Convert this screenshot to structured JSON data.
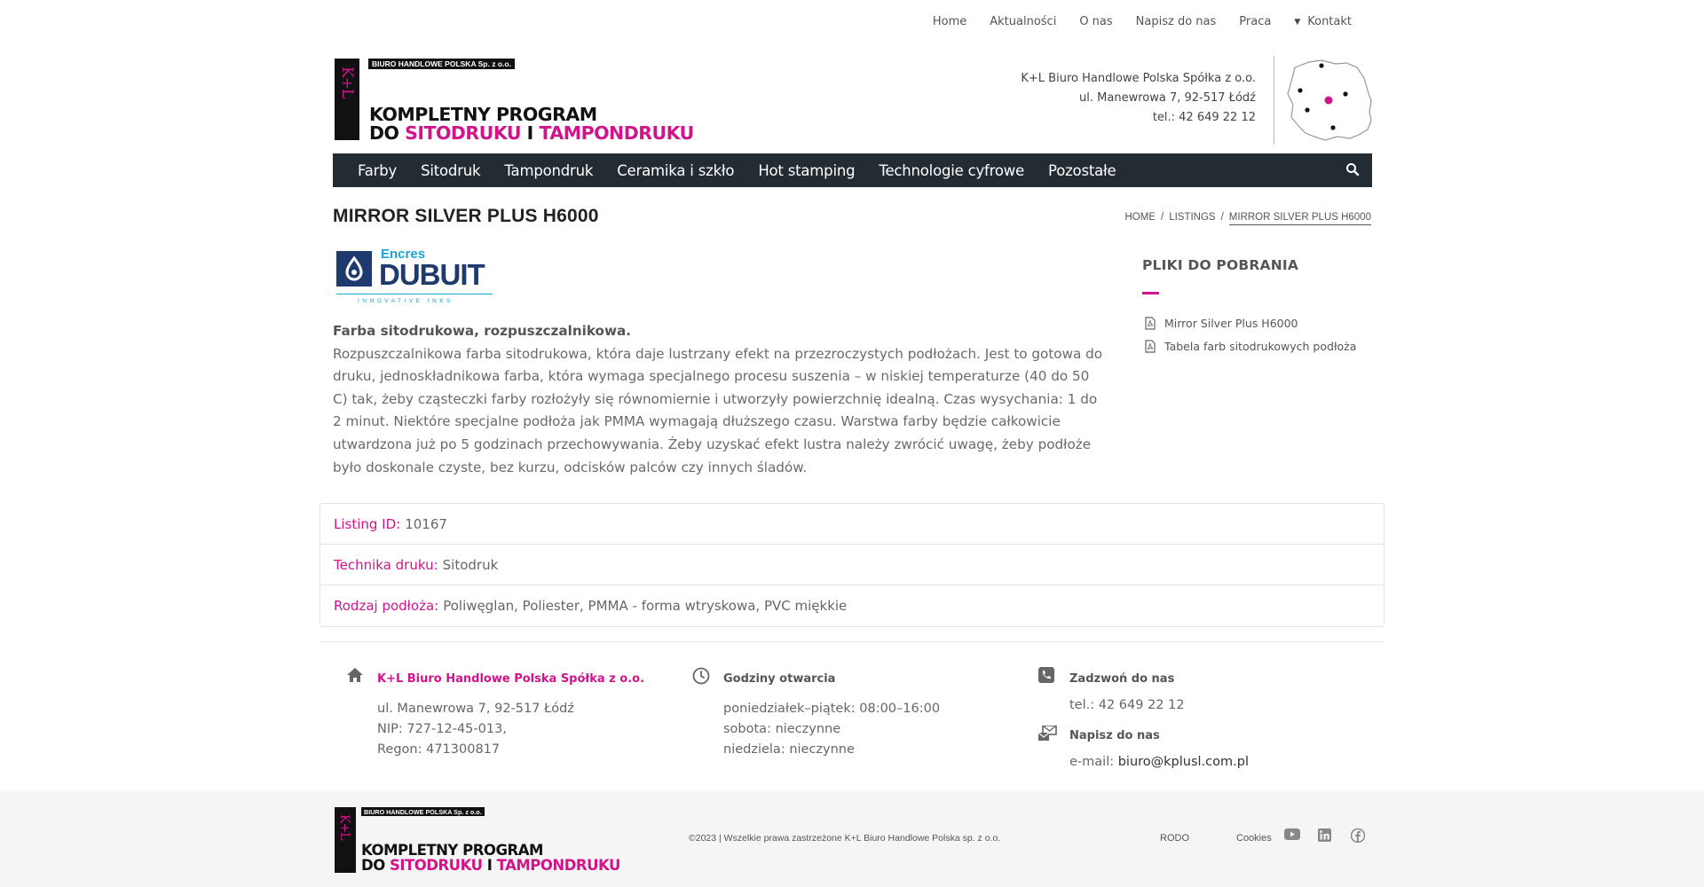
{
  "topnav": {
    "items": [
      "Home",
      "Aktualności",
      "O nas",
      "Napisz do nas",
      "Praca",
      "Kontakt"
    ]
  },
  "logo": {
    "band": "BIURO HANDLOWE POLSKA Sp. z o.o.",
    "letters": "K+L",
    "line1": "KOMPLETNY PROGRAM",
    "line2_prefix": "DO ",
    "line2_pink1": "SITODRUKU",
    "line2_mid": " I ",
    "line2_pink2": "TAMPONDRUKU"
  },
  "header_address": {
    "company": "K+L Biuro Handlowe Polska Spółka z o.o.",
    "street": "ul. Manewrowa 7, 92-517 Łódź",
    "phone": "tel.: 42 649 22 12"
  },
  "mainnav": {
    "items": [
      "Farby",
      "Sitodruk",
      "Tampondruk",
      "Ceramika i szkło",
      "Hot stamping",
      "Technologie cyfrowe",
      "Pozostałe"
    ]
  },
  "page": {
    "title": "MIRROR SILVER PLUS H6000",
    "breadcrumb": [
      "HOME",
      "LISTINGS",
      "MIRROR SILVER PLUS H6000"
    ]
  },
  "brand": {
    "top": "Encres",
    "name": "DUBUIT",
    "tagline": "INNOVATIVE INKS"
  },
  "description": {
    "lead": "Farba sitodrukowa, rozpuszczalnikowa.",
    "body": "Rozpuszczalnikowa farba sitodrukowa, która daje lustrzany efekt na przezroczystych podłożach. Jest to gotowa do druku, jednoskładnikowa farba, która wymaga specjalnego procesu suszenia – w niskiej temperaturze (40 do 50 C) tak, żeby cząsteczki farby rozłożyły się równomiernie i utworzyły powierzchnię idealną. Czas wysychania: 1 do 2 minut. Niektóre specjalne podłoża jak PMMA wymagają dłuższego czasu. Warstwa farby będzie całkowicie utwardzona już po 5 godzinach przechowywania. Żeby uzyskać efekt lustra należy zwrócić uwagę, żeby podłoże było doskonale czyste, bez kurzu, odcisków palców czy innych śladów."
  },
  "downloads": {
    "title": "PLIKI DO POBRANIA",
    "files": [
      "Mirror Silver Plus H6000",
      "Tabela farb sitodrukowych podłoża"
    ]
  },
  "details": [
    {
      "label": "Listing ID:",
      "value": "10167"
    },
    {
      "label": "Technika druku:",
      "value": "Sitodruk"
    },
    {
      "label": "Rodzaj podłoża:",
      "value": "Poliwęglan, Poliester, PMMA - forma wtryskowa, PVC miękkie"
    }
  ],
  "contact": {
    "company_head": "K+L Biuro Handlowe Polska Spółka z o.o.",
    "company_lines": [
      "ul. Manewrowa 7, 92-517 Łódź",
      "NIP: 727-12-45-013,",
      "Regon: 471300817"
    ],
    "hours_head": "Godziny otwarcia",
    "hours_lines": [
      "poniedziałek–piątek: 08:00–16:00",
      "sobota: nieczynne",
      "niedziela: nieczynne"
    ],
    "call_head": "Zadzwoń do nas",
    "call_line": "tel.: 42 649 22 12",
    "mail_head": "Napisz do nas",
    "mail_prefix": "e-mail: ",
    "mail_addr": "biuro@kplusl.com.pl"
  },
  "footer": {
    "copyright": "©2023 | Wszelkie prawa zastrzeżone K+L Biuro Handlowe Polska sp. z o.o.",
    "rodo": "RODO",
    "cookies": "Cookies"
  },
  "colors": {
    "accent": "#d1148a",
    "navbar": "#232b33",
    "brand_blue": "#1e3a6e",
    "brand_cyan": "#1aa3d8"
  }
}
